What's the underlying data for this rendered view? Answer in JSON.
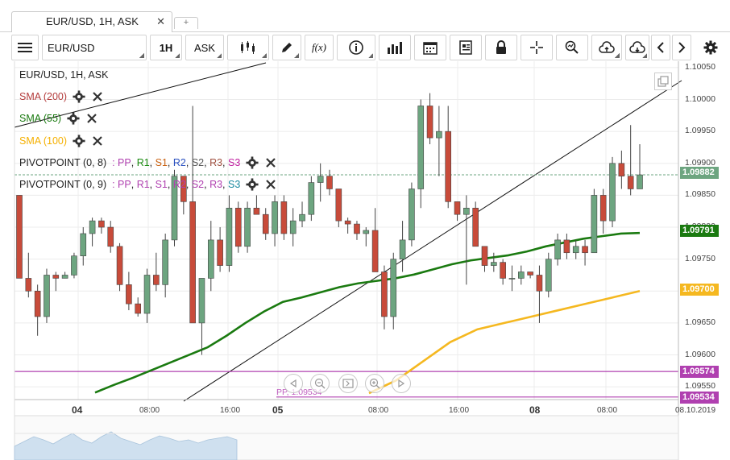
{
  "tab": {
    "title": "EUR/USD, 1H, ASK",
    "close": "✕",
    "add": "+"
  },
  "toolbar": {
    "symbol": "EUR/USD",
    "interval": "1H",
    "side": "ASK",
    "fx_label": "f(x)"
  },
  "legend": {
    "title": "EUR/USD, 1H, ASK",
    "sma200": "SMA (200)",
    "sma55": "SMA (55)",
    "sma100": "SMA (100)",
    "pivot8": {
      "name": "PIVOTPOINT (0, 8)",
      "sep": ":",
      "pp": "PP",
      "r1": "R1",
      "s1": "S1",
      "r2": "R2",
      "s2": "S2",
      "r3": "R3",
      "s3": "S3"
    },
    "pivot9": {
      "name": "PIVOTPOINT (0, 9)",
      "sep": ":",
      "pp": "PP",
      "r1": "R1",
      "s1": "S1",
      "r2": "R2",
      "s2": "S2",
      "r3": "R3",
      "s3": "S3"
    }
  },
  "colors": {
    "up": "#6da580",
    "down": "#c84b3a",
    "sma55": "#1a7a10",
    "sma100": "#f5b820",
    "pp": "#b040b0",
    "current": "#6da580",
    "sma200": "#b43c3c"
  },
  "y_axis": {
    "ticks": [
      "1.10050",
      "1.10000",
      "1.09950",
      "1.09900",
      "1.09850",
      "1.09800",
      "1.09750",
      "1.09700",
      "1.09650",
      "1.09600",
      "1.09550"
    ]
  },
  "price_tags": {
    "current": "1.09882",
    "sma55": "1.09791",
    "sma100": "1.09700",
    "pp8": "1.09574",
    "pp9": "1.09534"
  },
  "x_axis": {
    "labels": [
      {
        "text": "04",
        "major": true
      },
      {
        "text": "08:00",
        "major": false
      },
      {
        "text": "16:00",
        "major": false
      },
      {
        "text": "05",
        "major": true
      },
      {
        "text": "08:00",
        "major": false
      },
      {
        "text": "16:00",
        "major": false
      },
      {
        "text": "08",
        "major": true
      },
      {
        "text": "08:00",
        "major": false
      },
      {
        "text": "08.10.2019",
        "major": false
      }
    ]
  },
  "pp_label": "PP, 1.09534",
  "chart_data": {
    "type": "candlestick",
    "title": "EUR/USD, 1H, ASK",
    "ylim": [
      1.0953,
      1.1006
    ],
    "candles": [
      {
        "o": 1.0985,
        "h": 1.0985,
        "l": 1.0972,
        "c": 1.0972
      },
      {
        "o": 1.0972,
        "h": 1.0976,
        "l": 1.0969,
        "c": 1.097
      },
      {
        "o": 1.097,
        "h": 1.0971,
        "l": 1.0963,
        "c": 1.0966
      },
      {
        "o": 1.0966,
        "h": 1.09735,
        "l": 1.0965,
        "c": 1.09725
      },
      {
        "o": 1.09725,
        "h": 1.0973,
        "l": 1.097,
        "c": 1.0972
      },
      {
        "o": 1.0972,
        "h": 1.0973,
        "l": 1.0972,
        "c": 1.09725
      },
      {
        "o": 1.09725,
        "h": 1.0976,
        "l": 1.0972,
        "c": 1.09755
      },
      {
        "o": 1.09755,
        "h": 1.098,
        "l": 1.0974,
        "c": 1.0979
      },
      {
        "o": 1.0979,
        "h": 1.09815,
        "l": 1.0977,
        "c": 1.0981
      },
      {
        "o": 1.0981,
        "h": 1.09815,
        "l": 1.0979,
        "c": 1.098
      },
      {
        "o": 1.098,
        "h": 1.0981,
        "l": 1.0976,
        "c": 1.0977
      },
      {
        "o": 1.0977,
        "h": 1.09775,
        "l": 1.097,
        "c": 1.0971
      },
      {
        "o": 1.0971,
        "h": 1.0973,
        "l": 1.0967,
        "c": 1.0968
      },
      {
        "o": 1.0968,
        "h": 1.0969,
        "l": 1.0966,
        "c": 1.09665
      },
      {
        "o": 1.09665,
        "h": 1.09735,
        "l": 1.0965,
        "c": 1.09725
      },
      {
        "o": 1.09725,
        "h": 1.0976,
        "l": 1.097,
        "c": 1.0971
      },
      {
        "o": 1.0971,
        "h": 1.0979,
        "l": 1.0969,
        "c": 1.0978
      },
      {
        "o": 1.0978,
        "h": 1.0989,
        "l": 1.0977,
        "c": 1.0988
      },
      {
        "o": 1.0988,
        "h": 1.0986,
        "l": 1.0982,
        "c": 1.0984
      },
      {
        "o": 1.0984,
        "h": 1.0999,
        "l": 1.0965,
        "c": 1.0965
      },
      {
        "o": 1.0965,
        "h": 1.0972,
        "l": 1.096,
        "c": 1.0972
      },
      {
        "o": 1.0972,
        "h": 1.0981,
        "l": 1.097,
        "c": 1.0978
      },
      {
        "o": 1.0978,
        "h": 1.098,
        "l": 1.0973,
        "c": 1.0974
      },
      {
        "o": 1.0974,
        "h": 1.0985,
        "l": 1.0973,
        "c": 1.0983
      },
      {
        "o": 1.0983,
        "h": 1.0984,
        "l": 1.0976,
        "c": 1.0977
      },
      {
        "o": 1.0977,
        "h": 1.0984,
        "l": 1.0976,
        "c": 1.0983
      },
      {
        "o": 1.0983,
        "h": 1.0985,
        "l": 1.0982,
        "c": 1.0982
      },
      {
        "o": 1.0982,
        "h": 1.0983,
        "l": 1.0978,
        "c": 1.0979
      },
      {
        "o": 1.0979,
        "h": 1.0985,
        "l": 1.0977,
        "c": 1.0984
      },
      {
        "o": 1.0984,
        "h": 1.0985,
        "l": 1.0978,
        "c": 1.0979
      },
      {
        "o": 1.0979,
        "h": 1.0983,
        "l": 1.0977,
        "c": 1.0981
      },
      {
        "o": 1.0981,
        "h": 1.0984,
        "l": 1.098,
        "c": 1.0982
      },
      {
        "o": 1.0982,
        "h": 1.0988,
        "l": 1.0981,
        "c": 1.0987
      },
      {
        "o": 1.0987,
        "h": 1.099,
        "l": 1.0984,
        "c": 1.0988
      },
      {
        "o": 1.0988,
        "h": 1.0989,
        "l": 1.0985,
        "c": 1.0986
      },
      {
        "o": 1.0986,
        "h": 1.0986,
        "l": 1.098,
        "c": 1.0981
      },
      {
        "o": 1.0981,
        "h": 1.09815,
        "l": 1.0979,
        "c": 1.09805
      },
      {
        "o": 1.09805,
        "h": 1.0981,
        "l": 1.0978,
        "c": 1.0979
      },
      {
        "o": 1.0979,
        "h": 1.098,
        "l": 1.0977,
        "c": 1.09795
      },
      {
        "o": 1.09795,
        "h": 1.0983,
        "l": 1.0973,
        "c": 1.0973
      },
      {
        "o": 1.0973,
        "h": 1.0974,
        "l": 1.0964,
        "c": 1.0966
      },
      {
        "o": 1.0966,
        "h": 1.0976,
        "l": 1.0964,
        "c": 1.0975
      },
      {
        "o": 1.0975,
        "h": 1.0981,
        "l": 1.0973,
        "c": 1.0978
      },
      {
        "o": 1.0978,
        "h": 1.0987,
        "l": 1.0977,
        "c": 1.0986
      },
      {
        "o": 1.0986,
        "h": 1.1,
        "l": 1.0983,
        "c": 1.0999
      },
      {
        "o": 1.0999,
        "h": 1.1001,
        "l": 1.0993,
        "c": 1.0994
      },
      {
        "o": 1.0994,
        "h": 1.0999,
        "l": 1.0988,
        "c": 1.0995
      },
      {
        "o": 1.0995,
        "h": 1.0999,
        "l": 1.0983,
        "c": 1.0984
      },
      {
        "o": 1.0984,
        "h": 1.0984,
        "l": 1.0981,
        "c": 1.0982
      },
      {
        "o": 1.0982,
        "h": 1.0985,
        "l": 1.0971,
        "c": 1.0983
      },
      {
        "o": 1.0983,
        "h": 1.0984,
        "l": 1.0977,
        "c": 1.0977
      },
      {
        "o": 1.0977,
        "h": 1.0977,
        "l": 1.0973,
        "c": 1.0974
      },
      {
        "o": 1.0974,
        "h": 1.0976,
        "l": 1.0973,
        "c": 1.09745
      },
      {
        "o": 1.09745,
        "h": 1.0975,
        "l": 1.0971,
        "c": 1.0972
      },
      {
        "o": 1.0972,
        "h": 1.0974,
        "l": 1.097,
        "c": 1.0972
      },
      {
        "o": 1.0972,
        "h": 1.0974,
        "l": 1.0971,
        "c": 1.0973
      },
      {
        "o": 1.0973,
        "h": 1.0973,
        "l": 1.0972,
        "c": 1.09725
      },
      {
        "o": 1.09725,
        "h": 1.0974,
        "l": 1.0965,
        "c": 1.097
      },
      {
        "o": 1.097,
        "h": 1.0976,
        "l": 1.0969,
        "c": 1.0975
      },
      {
        "o": 1.0975,
        "h": 1.0979,
        "l": 1.0974,
        "c": 1.0978
      },
      {
        "o": 1.0978,
        "h": 1.0979,
        "l": 1.0975,
        "c": 1.0976
      },
      {
        "o": 1.0976,
        "h": 1.0978,
        "l": 1.0975,
        "c": 1.0977
      },
      {
        "o": 1.0977,
        "h": 1.0978,
        "l": 1.0974,
        "c": 1.0976
      },
      {
        "o": 1.0976,
        "h": 1.0986,
        "l": 1.0976,
        "c": 1.0985
      },
      {
        "o": 1.0985,
        "h": 1.0986,
        "l": 1.0979,
        "c": 1.0981
      },
      {
        "o": 1.0981,
        "h": 1.0991,
        "l": 1.098,
        "c": 1.099
      },
      {
        "o": 1.099,
        "h": 1.0992,
        "l": 1.0986,
        "c": 1.0988
      },
      {
        "o": 1.0988,
        "h": 1.0996,
        "l": 1.0985,
        "c": 1.0986
      },
      {
        "o": 1.0986,
        "h": 1.0993,
        "l": 1.0986,
        "c": 1.09882
      }
    ],
    "sma55": [
      1.09541,
      1.09553,
      1.09564,
      1.09576,
      1.09588,
      1.096,
      1.09612,
      1.0963,
      1.0965,
      1.09668,
      1.09683,
      1.0969,
      1.09698,
      1.09706,
      1.09712,
      1.09716,
      1.0972,
      1.09726,
      1.09734,
      1.09742,
      1.09748,
      1.09752,
      1.09756,
      1.09762,
      1.0977,
      1.09776,
      1.09782,
      1.09786,
      1.0979,
      1.09791
    ],
    "sma100": [
      1.0954,
      1.0956,
      1.0959,
      1.0962,
      1.0964,
      1.0965,
      1.0966,
      1.0967,
      1.0968,
      1.0969,
      1.097
    ],
    "pivot_pp8": 1.09574,
    "pivot_pp9": 1.09534
  }
}
